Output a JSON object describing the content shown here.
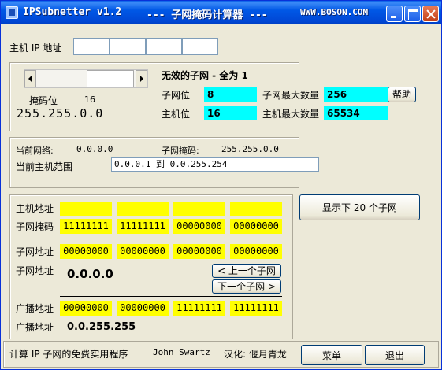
{
  "window": {
    "title_app": "IPSubnetter v1.2",
    "title_center": "--- 子网掩码计算器 ---",
    "title_site": "WWW.BOSON.COM"
  },
  "host_ip": {
    "label": "主机 IP 地址",
    "octets": [
      "",
      "",
      "",
      ""
    ]
  },
  "mask": {
    "bits_label": "掩码位",
    "bits_value": "16",
    "mask_value": "255.255.0.0",
    "slider_level_bits": 16
  },
  "info": {
    "heading": "无效的子网 - 全为 1",
    "subnet_bits_label": "子网位",
    "subnet_bits_value": "8",
    "max_subnets_label": "子网最大数量",
    "max_subnets_value": "256",
    "help_button": "帮助",
    "host_bits_label": "主机位",
    "host_bits_value": "16",
    "max_hosts_label": "主机最大数量",
    "max_hosts_value": "65534"
  },
  "network": {
    "current_network_label": "当前网络:",
    "current_network_value": "0.0.0.0",
    "subnet_mask_label": "子网掩码:",
    "subnet_mask_value": "255.255.0.0",
    "host_range_label": "当前主机范围",
    "host_range_value": "0.0.0.1 到 0.0.255.254"
  },
  "binary": {
    "host_address_label": "主机地址",
    "host_address_octets": [
      "",
      "",
      "",
      ""
    ],
    "subnet_mask_label": "子网掩码",
    "subnet_mask_octets": [
      "11111111",
      "11111111",
      "00000000",
      "00000000"
    ],
    "subnet_address_label": "子网地址",
    "subnet_address_octets": [
      "00000000",
      "00000000",
      "00000000",
      "00000000"
    ],
    "subnet_address_label2": "子网地址",
    "subnet_address_value": "0.0.0.0",
    "prev_subnet_button": "< 上一个子网",
    "next_subnet_button": "下一个子网 >",
    "broadcast_label": "广播地址",
    "broadcast_octets": [
      "00000000",
      "00000000",
      "11111111",
      "11111111"
    ],
    "broadcast_label2": "广播地址",
    "broadcast_value": "0.0.255.255"
  },
  "show_subnets_button": "显示下 20 个子网",
  "footer": {
    "description": "计算 IP 子网的免费实用程序",
    "author": "John Swartz",
    "translator": "汉化: 偃月青龙",
    "menu_button": "菜单",
    "exit_button": "退出"
  },
  "colors": {
    "cyan_field": "#00ffff",
    "yellow_field": "#ffff00",
    "titlebar": "#0058e6",
    "window_bg": "#ece9d8"
  }
}
